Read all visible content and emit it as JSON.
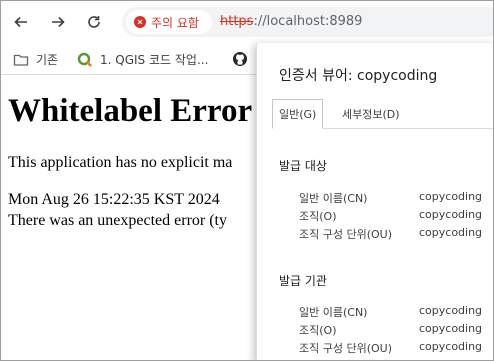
{
  "toolbar": {
    "security_label": "주의 요함",
    "url_scheme": "https",
    "url_rest": "://localhost:8989"
  },
  "bookmarks": [
    {
      "label": "기존"
    },
    {
      "label": "1. QGIS 코드 작업..."
    }
  ],
  "page": {
    "heading": "Whitelabel Error",
    "line1": "This application has no explicit ma",
    "line2": "Mon Aug 26 15:22:35 KST 2024",
    "line3": "There was an unexpected error (ty"
  },
  "cert_viewer": {
    "title": "인증서 뷰어: copycoding",
    "tabs": [
      "일반(G)",
      "세부정보(D)"
    ],
    "issued_to": {
      "title": "발급 대상",
      "rows": [
        {
          "key": "일반 이름(CN)",
          "value": "copycoding"
        },
        {
          "key": "조직(O)",
          "value": "copycoding"
        },
        {
          "key": "조직 구성 단위(OU)",
          "value": "copycoding"
        }
      ]
    },
    "issued_by": {
      "title": "발급 기관",
      "rows": [
        {
          "key": "일반 이름(CN)",
          "value": "copycoding"
        },
        {
          "key": "조직(O)",
          "value": "copycoding"
        },
        {
          "key": "조직 구성 단위(OU)",
          "value": "copycoding"
        }
      ]
    }
  },
  "colors": {
    "warning": "#d93025",
    "omnibox_bg": "#f1f3f4"
  }
}
